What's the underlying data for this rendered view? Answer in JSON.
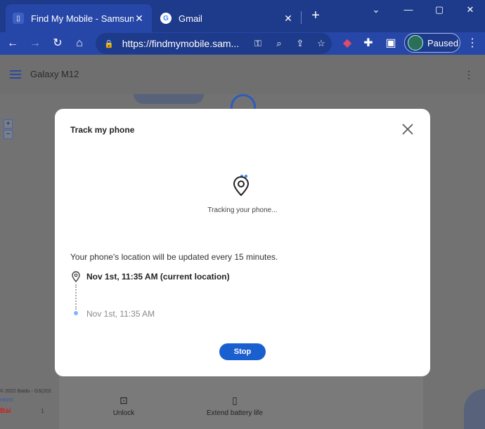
{
  "browser": {
    "tabs": [
      {
        "title": "Find My Mobile - Samsung",
        "favicon": "samsung-icon",
        "active": true
      },
      {
        "title": "Gmail",
        "favicon": "google-icon",
        "active": false
      }
    ],
    "url": "https://findmymobile.sam...",
    "profile_status": "Paused"
  },
  "app": {
    "device_name": "Galaxy M12",
    "bottom_actions": [
      {
        "label": "Unlock",
        "icon": "unlock-icon"
      },
      {
        "label": "Extend battery life",
        "icon": "battery-icon"
      }
    ],
    "map_attribution": "© 2022 Baidu - GS(202",
    "map_here": "HERE",
    "map_brand": "Bai",
    "map_scale": "1"
  },
  "modal": {
    "title": "Track my phone",
    "status": "Tracking your phone...",
    "info": "Your phone's location will be updated every 15 minutes.",
    "history": [
      {
        "text": "Nov 1st, 11:35 AM (current location)",
        "current": true
      },
      {
        "text": "Nov 1st, 11:35 AM",
        "current": false
      }
    ],
    "stop_label": "Stop"
  },
  "colors": {
    "accent": "#1a5fd0",
    "chrome": "#1e3a8a",
    "toolbar": "#2747a8"
  }
}
